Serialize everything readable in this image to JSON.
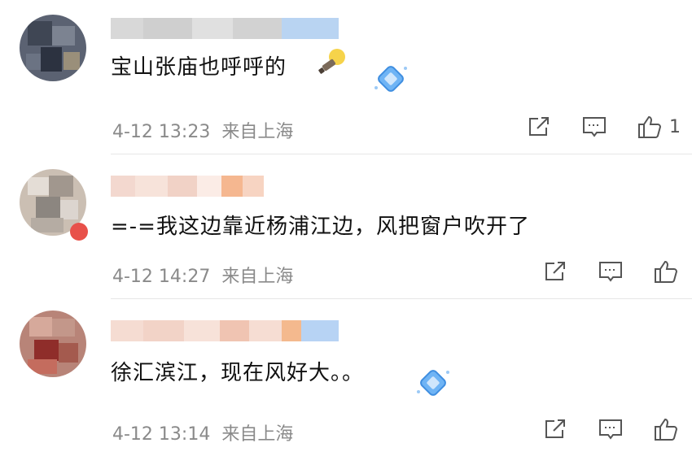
{
  "comments": [
    {
      "text": "宝山张庙也呼呼的",
      "date": "4-12 13:23",
      "location": "来自上海",
      "likes": "1",
      "has_badge": true,
      "has_emoji": true
    },
    {
      "text": "=-=我这边靠近杨浦江边，风把窗户吹开了",
      "date": "4-12 14:27",
      "location": "来自上海",
      "likes": "",
      "has_badge": false,
      "has_emoji": false
    },
    {
      "text": "徐汇滨江，现在风好大。。",
      "date": "4-12 13:14",
      "location": "来自上海",
      "likes": "",
      "has_badge": true,
      "has_emoji": false
    }
  ],
  "icons": {
    "share": "share-icon",
    "reply": "comment-icon",
    "like": "thumbs-up-icon"
  },
  "colors": {
    "text": "#111111",
    "meta": "#8a8a8a",
    "icon": "#555555",
    "badge": "#5aa7f0",
    "divider": "#e6e6e6"
  }
}
